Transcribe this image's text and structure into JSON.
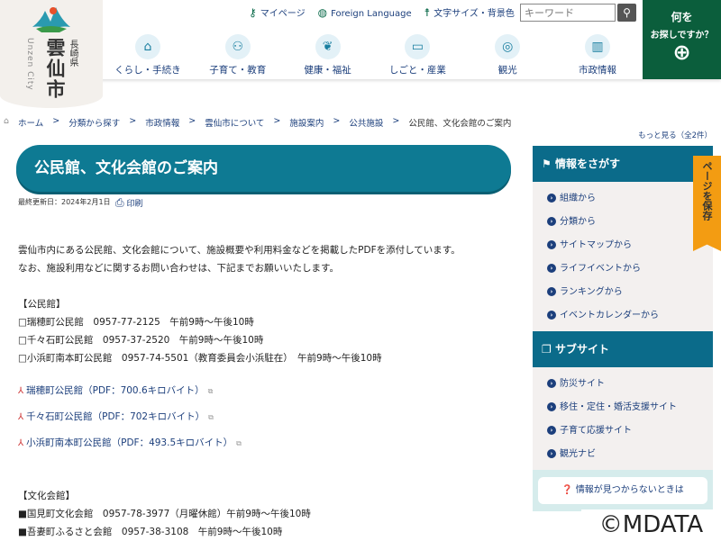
{
  "header": {
    "city_name": "雲仙市",
    "prefecture": "長崎県",
    "city_en": "Unzen City",
    "utility": [
      {
        "icon": "key-icon",
        "label": "マイページ"
      },
      {
        "icon": "globe-icon",
        "label": "Foreign Language"
      },
      {
        "icon": "person-icon",
        "label": "文字サイズ・背景色"
      }
    ],
    "search_placeholder": "キーワード",
    "nav": [
      {
        "icon": "house-icon",
        "label": "くらし・手続き"
      },
      {
        "icon": "family-icon",
        "label": "子育て・教育"
      },
      {
        "icon": "leaf-icon",
        "label": "健康・福祉"
      },
      {
        "icon": "briefcase-icon",
        "label": "しごと・産業"
      },
      {
        "icon": "camera-icon",
        "label": "観光"
      },
      {
        "icon": "building-icon",
        "label": "市政情報"
      }
    ],
    "find": {
      "line1": "何を",
      "line2": "お探しですか？"
    }
  },
  "breadcrumb": [
    "ホーム",
    "分類から探す",
    "市政情報",
    "雲仙市について",
    "施設案内",
    "公共施設",
    "公民館、文化会館のご案内"
  ],
  "more_link": "もっと見る（全2件）",
  "page": {
    "title": "公民館、文化会館のご案内",
    "updated": "最終更新日：2024年2月1日",
    "print": "印刷",
    "intro": [
      "雲仙市内にある公民館、文化会館について、施設概要や利用料金などを掲載したPDFを添付しています。",
      "なお、施設利用などに関するお問い合わせは、下記までお願いいたします。"
    ],
    "kominkan_heading": "【公民館】",
    "kominkan": [
      "□瑞穂町公民館　0957-77-2125　午前9時～午後10時",
      "□千々石町公民館　0957-37-2520　午前9時～午後10時",
      "□小浜町南本町公民館　0957-74-5501（教育委員会小浜駐在）　午前9時～午後10時"
    ],
    "pdfs": [
      "瑞穂町公民館（PDF：700.6キロバイト）",
      "千々石町公民館（PDF：702キロバイト）",
      "小浜町南本町公民館（PDF：493.5キロバイト）"
    ],
    "bunka_heading": "【文化会館】",
    "bunka": [
      "■国見町文化会館　0957-78-3977（月曜休館）午前9時～午後10時",
      "■吾妻町ふるさと会館　0957-38-3108　午前9時～午後10時"
    ]
  },
  "sidebar": {
    "find_title": "情報をさがす",
    "find_items": [
      "組織から",
      "分類から",
      "サイトマップから",
      "ライフイベントから",
      "ランキングから",
      "イベントカレンダーから"
    ],
    "sub_title": "サブサイト",
    "sub_items": [
      "防災サイト",
      "移住・定住・婚活支援サイト",
      "子育て応援サイト",
      "観光ナビ"
    ],
    "not_found": "情報が見つからないときは"
  },
  "save_tab": "ページを保存",
  "watermark": "©MDATA",
  "colors": {
    "title": "#0e7a93",
    "find_box": "#0b5e3c",
    "save_tab": "#f39c12",
    "sidebar_header": "#0b6b8a"
  }
}
